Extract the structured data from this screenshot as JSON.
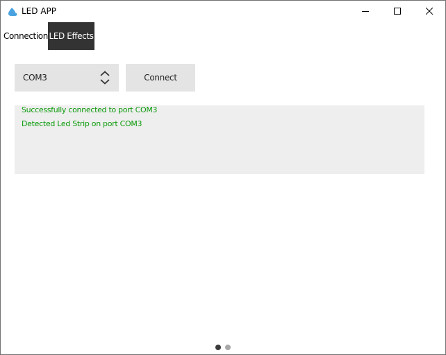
{
  "window": {
    "title": "LED APP",
    "icon": "droplet-icon"
  },
  "tabs": [
    {
      "label": "Connection",
      "active": false
    },
    {
      "label": "LED Effects",
      "active": true
    }
  ],
  "connection": {
    "port_selected": "COM3",
    "connect_label": "Connect"
  },
  "log": {
    "lines": [
      "Successfully connected to port COM3",
      "Detected Led Strip on port COM3"
    ],
    "text_color": "#0a9a0a"
  },
  "pager": {
    "pages": 2,
    "current": 1
  },
  "colors": {
    "active_tab_bg": "#333333",
    "control_bg": "#e4e4e4",
    "log_bg": "#eeeeee",
    "app_icon": "#4aa3e0"
  }
}
